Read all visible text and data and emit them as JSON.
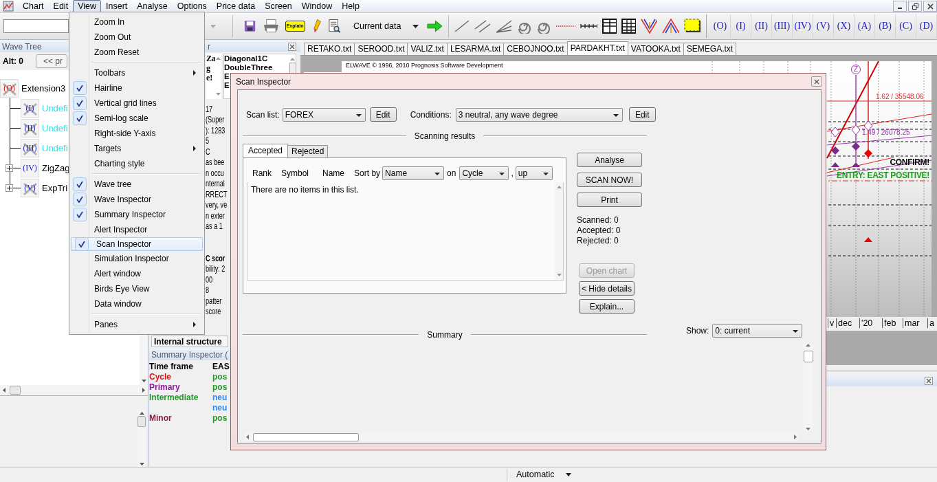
{
  "menubar": {
    "items": [
      {
        "label": "Chart",
        "selected": false
      },
      {
        "label": "Edit",
        "selected": false
      },
      {
        "label": "View",
        "selected": true
      },
      {
        "label": "Insert",
        "selected": false
      },
      {
        "label": "Analyse",
        "selected": false
      },
      {
        "label": "Options",
        "selected": false
      },
      {
        "label": "Price data",
        "selected": false
      },
      {
        "label": "Screen",
        "selected": false
      },
      {
        "label": "Window",
        "selected": false
      },
      {
        "label": "Help",
        "selected": false
      }
    ]
  },
  "toolbar": {
    "tools_1": [
      {
        "kind": "save"
      },
      {
        "kind": "print"
      },
      {
        "kind": "explain",
        "label": "Explain"
      },
      {
        "kind": "marker"
      },
      {
        "kind": "report"
      }
    ],
    "data_selector": {
      "value": "Current data"
    },
    "tools_2": [
      {
        "kind": "go"
      },
      {
        "kind": "line"
      },
      {
        "kind": "parallel"
      },
      {
        "kind": "fan"
      },
      {
        "kind": "spiral"
      },
      {
        "kind": "spiral"
      },
      {
        "kind": "dotted"
      },
      {
        "kind": "ruler"
      },
      {
        "kind": "grid"
      },
      {
        "kind": "grid-fine"
      },
      {
        "kind": "v-shape"
      },
      {
        "kind": "a-shape"
      },
      {
        "kind": "rect"
      }
    ],
    "wave_buttons": [
      "(O)",
      "(I)",
      "(II)",
      "(III)",
      "(IV)",
      "(V)",
      "(X)",
      "(A)",
      "(B)",
      "(C)",
      "(D)"
    ]
  },
  "wave_tree": {
    "title": "Wave Tree",
    "alt": "Alt: 0",
    "previous_button": "<< pr",
    "nodes": [
      {
        "symbol": "(O)",
        "label": "Extension3",
        "color": "#000000",
        "crossed": true,
        "children": [
          {
            "symbol": "(I)",
            "label": "Undefi",
            "color": "#33dddd",
            "crossed": true,
            "collapsed": false
          },
          {
            "symbol": "(II)",
            "label": "Undefi",
            "color": "#33dddd",
            "crossed": true,
            "collapsed": false
          },
          {
            "symbol": "(III)",
            "label": "Undefi",
            "color": "#33dddd",
            "crossed": true,
            "collapsed": false
          },
          {
            "symbol": "(IV)",
            "label": "ZigZag",
            "color": "#000000",
            "crossed": false,
            "collapsed": true
          },
          {
            "symbol": "(V)",
            "label": "ExpTri",
            "color": "#000000",
            "crossed": true,
            "collapsed": true
          }
        ]
      }
    ]
  },
  "wave_inspector": {
    "title": "r",
    "list_1": [
      "Za",
      "g",
      "e!"
    ],
    "list_2": [
      "Diagonal1C",
      "DoubleThree",
      "E",
      "E"
    ],
    "lines_1": [
      {
        "text": "17",
        "bold": false
      },
      {
        "text": "(Super",
        "bold": false
      },
      {
        "text": "): 1283",
        "bold": false
      },
      {
        "text": "5",
        "bold": false
      },
      {
        "text": "C",
        "bold": false
      },
      {
        "text": "as bee",
        "bold": false
      },
      {
        "text": "n occu",
        "bold": false
      },
      {
        "text": "nternal",
        "bold": false
      },
      {
        "text": "RRECT",
        "bold": false
      },
      {
        "text": "very, ve",
        "bold": false
      },
      {
        "text": "n exter",
        "bold": false
      },
      {
        "text": "as a 1",
        "bold": false
      }
    ],
    "lines_2": [
      {
        "text": "C scor",
        "bold": true
      },
      {
        "text": "bility: 2",
        "bold": false
      },
      {
        "text": "00",
        "bold": false
      },
      {
        "text": "8",
        "bold": false
      },
      {
        "text": "patter",
        "bold": false
      },
      {
        "text": "score",
        "bold": false
      }
    ],
    "section": "Internal structure"
  },
  "summary_inspector": {
    "title": "Summary Inspector (",
    "header": [
      "Time frame",
      "EAS"
    ],
    "rows": [
      {
        "frame": {
          "text": "Cycle",
          "color": "#dd1111"
        },
        "value": {
          "text": "pos",
          "color": "#22992a"
        }
      },
      {
        "frame": {
          "text": "Primary",
          "color": "#8b1a9b"
        },
        "value": {
          "text": "pos",
          "color": "#22992a"
        }
      },
      {
        "frame": {
          "text": "Intermediate",
          "color": "#22992a"
        },
        "value": {
          "text": "neu",
          "color": "#3388ee"
        }
      },
      {
        "value": {
          "text": "neu",
          "color": "#3388ee"
        }
      },
      {
        "frame": {
          "text": "Minor",
          "color": "#8b1a4a"
        },
        "value": {
          "text": "pos",
          "color": "#22992a"
        }
      }
    ]
  },
  "chart": {
    "tabs": [
      {
        "label": "RETAKO.txt",
        "selected": false
      },
      {
        "label": "SEROOD.txt",
        "selected": false
      },
      {
        "label": "VALIZ.txt",
        "selected": false
      },
      {
        "label": "LESARMA.txt",
        "selected": false
      },
      {
        "label": "CEBOJNOO.txt",
        "selected": false
      },
      {
        "label": "PARDAKHT.txt",
        "selected": true
      },
      {
        "label": "VATOOKA.txt",
        "selected": false
      },
      {
        "label": "SEMEGA.txt",
        "selected": false
      }
    ],
    "credit": "ELWAVE © 1996, 2010 Prognosis Software Development",
    "wave_label": "Z",
    "price_labels": [
      {
        "text": "1.62 / 35548.06",
        "color": "#e03030"
      },
      {
        "text": "1.49 / 26078.25",
        "color": "#9933aa"
      }
    ],
    "signals": [
      {
        "text": "CONFIRM!",
        "color": "#000000"
      },
      {
        "text": "ENTRY: EAST POSITIVE!",
        "color": "#229922"
      }
    ],
    "x_labels": [
      "v",
      "dec",
      "'20",
      "feb",
      "mar",
      "a"
    ]
  },
  "view_menu": {
    "groups": [
      [
        {
          "label": "Zoom In",
          "checked": false,
          "submenu": false,
          "selected": false
        },
        {
          "label": "Zoom Out",
          "checked": false,
          "submenu": false,
          "selected": false
        },
        {
          "label": "Zoom Reset",
          "checked": false,
          "submenu": false,
          "selected": false
        }
      ],
      [
        {
          "label": "Toolbars",
          "checked": false,
          "submenu": true,
          "selected": false
        },
        {
          "label": "Hairline",
          "checked": true,
          "submenu": false,
          "selected": false
        },
        {
          "label": "Vertical grid lines",
          "checked": true,
          "submenu": false,
          "selected": false
        },
        {
          "label": "Semi-log scale",
          "checked": true,
          "submenu": false,
          "selected": false
        },
        {
          "label": "Right-side Y-axis",
          "checked": false,
          "submenu": false,
          "selected": false
        },
        {
          "label": "Targets",
          "checked": false,
          "submenu": true,
          "selected": false
        },
        {
          "label": "Charting style",
          "checked": false,
          "submenu": false,
          "selected": false
        }
      ],
      [
        {
          "label": "Wave tree",
          "checked": true,
          "submenu": false,
          "selected": false
        },
        {
          "label": "Wave Inspector",
          "checked": true,
          "submenu": false,
          "selected": false
        },
        {
          "label": "Summary Inspector",
          "checked": true,
          "submenu": false,
          "selected": false
        },
        {
          "label": "Alert Inspector",
          "checked": false,
          "submenu": false,
          "selected": false
        },
        {
          "label": "Scan Inspector",
          "checked": true,
          "submenu": false,
          "selected": true
        },
        {
          "label": "Simulation Inspector",
          "checked": false,
          "submenu": false,
          "selected": false
        },
        {
          "label": "Alert window",
          "checked": false,
          "submenu": false,
          "selected": false
        },
        {
          "label": "Birds Eye View",
          "checked": false,
          "submenu": false,
          "selected": false
        },
        {
          "label": "Data window",
          "checked": false,
          "submenu": false,
          "selected": false
        }
      ],
      [
        {
          "label": "Panes",
          "checked": false,
          "submenu": true,
          "selected": false
        }
      ]
    ]
  },
  "scan_inspector": {
    "title": "Scan Inspector",
    "scan_list": {
      "label": "Scan list:",
      "value": "FOREX",
      "button": "Edit"
    },
    "conditions": {
      "label": "Conditions:",
      "value": "3 neutral, any wave degree",
      "button": "Edit"
    },
    "results_heading": "Scanning results",
    "tabs": [
      {
        "label": "Accepted",
        "selected": true
      },
      {
        "label": "Rejected",
        "selected": false
      }
    ],
    "columns": [
      "Rank",
      "Symbol",
      "Name"
    ],
    "sort": {
      "label": "Sort by",
      "field": "Name",
      "on_label": "on",
      "degree": "Cycle",
      "separator": ",",
      "direction": "up"
    },
    "empty_message": "There are no items in this list.",
    "actions": [
      {
        "label": "Analyse",
        "disabled": false
      },
      {
        "label": "SCAN NOW!",
        "disabled": false
      },
      {
        "label": "Print",
        "disabled": false
      }
    ],
    "counts": [
      "Scanned: 0",
      "Accepted: 0",
      "Rejected: 0"
    ],
    "detail_buttons": [
      {
        "label": "Open chart",
        "disabled": true
      },
      {
        "label": "< Hide details",
        "disabled": false
      },
      {
        "label": "Explain...",
        "disabled": false
      }
    ],
    "summary_heading": "Summary",
    "show": {
      "label": "Show:",
      "value": "0: current"
    }
  },
  "status_bar": {
    "mode": "Automatic"
  }
}
